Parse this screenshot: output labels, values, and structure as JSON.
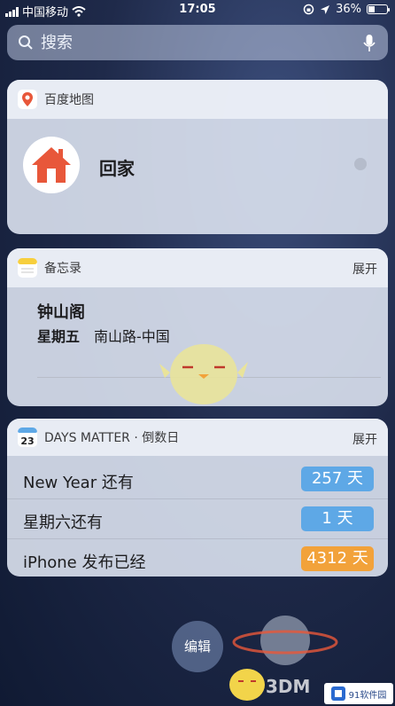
{
  "status_bar": {
    "carrier": "中国移动",
    "time": "17:05",
    "battery_percent": "36%",
    "battery_level": 0.36
  },
  "search": {
    "placeholder": "搜索"
  },
  "baidu_map": {
    "app_name": "百度地图",
    "destination_label": "回家"
  },
  "notes": {
    "app_name": "备忘录",
    "expand_label": "展开",
    "note_title": "钟山阁",
    "note_day": "星期五",
    "note_place": "南山路-中国"
  },
  "days_matter": {
    "calendar_day": "23",
    "app_name": "DAYS MATTER · 倒数日",
    "expand_label": "展开",
    "rows": [
      {
        "text": "New Year 还有",
        "badge": "257 天",
        "color": "#5ea8e6"
      },
      {
        "text": "星期六还有",
        "badge": "1 天",
        "color": "#5ea8e6"
      },
      {
        "text": "iPhone 发布已经",
        "badge": "4312 天",
        "color": "#f2a23a"
      }
    ]
  },
  "edit_label": "编辑",
  "watermarks": {
    "brand_3dm": "3DM",
    "brand_91": "91软件园"
  },
  "colors": {
    "accent_blue": "#5ea8e6",
    "accent_orange": "#f2a23a",
    "house_red": "#e8573a"
  }
}
